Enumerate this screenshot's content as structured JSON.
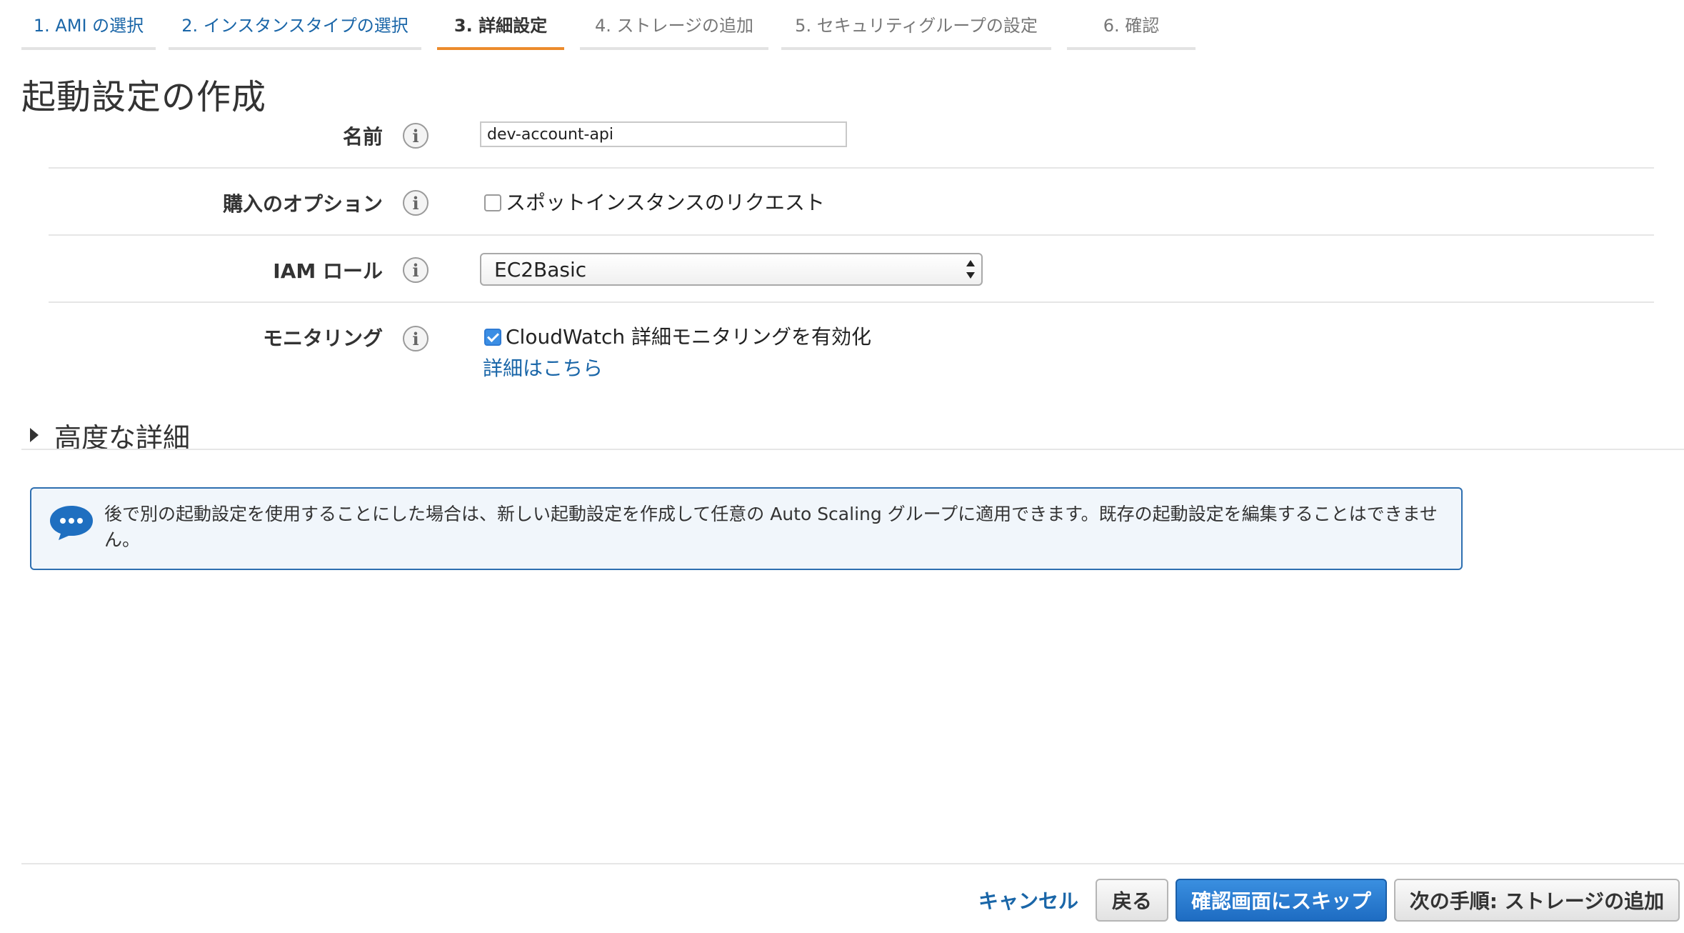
{
  "wizard": {
    "tabs": [
      {
        "label": "1. AMI の選択",
        "state": "done"
      },
      {
        "label": "2. インスタンスタイプの選択",
        "state": "done"
      },
      {
        "label": "3. 詳細設定",
        "state": "active"
      },
      {
        "label": "4. ストレージの追加",
        "state": "todo"
      },
      {
        "label": "5. セキュリティグループの設定",
        "state": "todo"
      },
      {
        "label": "6. 確認",
        "state": "todo"
      }
    ]
  },
  "page": {
    "title": "起動設定の作成"
  },
  "form": {
    "name": {
      "label": "名前",
      "value": "dev-account-api"
    },
    "purchase": {
      "label": "購入のオプション",
      "checkbox_label": "スポットインスタンスのリクエスト",
      "checked": false
    },
    "iam": {
      "label": "IAM ロール",
      "selected": "EC2Basic"
    },
    "monitoring": {
      "label": "モニタリング",
      "checkbox_label": "CloudWatch 詳細モニタリングを有効化",
      "checked": true,
      "link": "詳細はこちら"
    },
    "info_icon_glyph": "i"
  },
  "advanced": {
    "label": "高度な詳細"
  },
  "notice": {
    "text": "後で別の起動設定を使用することにした場合は、新しい起動設定を作成して任意の Auto Scaling グループに適用できます。既存の起動設定を編集することはできません。"
  },
  "footer": {
    "cancel": "キャンセル",
    "back": "戻る",
    "skip": "確認画面にスキップ",
    "next": "次の手順: ストレージの追加"
  },
  "colors": {
    "link": "#1a66a8",
    "active_tab_underline": "#ec8b2c",
    "primary_button": "#1e6cc2",
    "notice_border": "#2e6fb0"
  }
}
